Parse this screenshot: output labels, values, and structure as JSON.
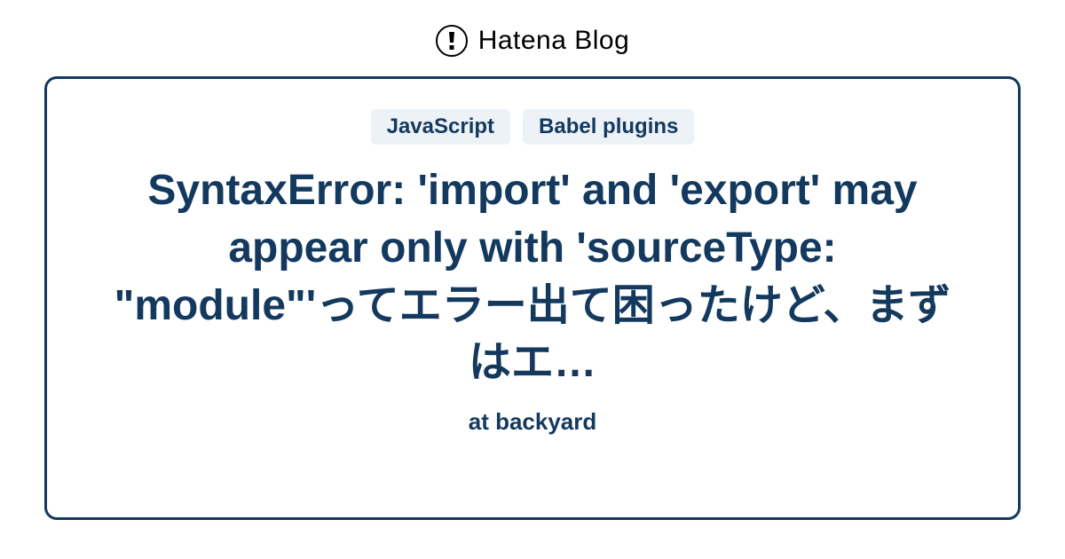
{
  "header": {
    "brand_text": "Hatena Blog"
  },
  "card": {
    "tags": [
      "JavaScript",
      "Babel plugins"
    ],
    "title": "SyntaxError: 'import' and 'export' may appear only with 'sourceType: \"module\"'ってエラー出て困ったけど、まずはエ…",
    "author": "at backyard"
  }
}
